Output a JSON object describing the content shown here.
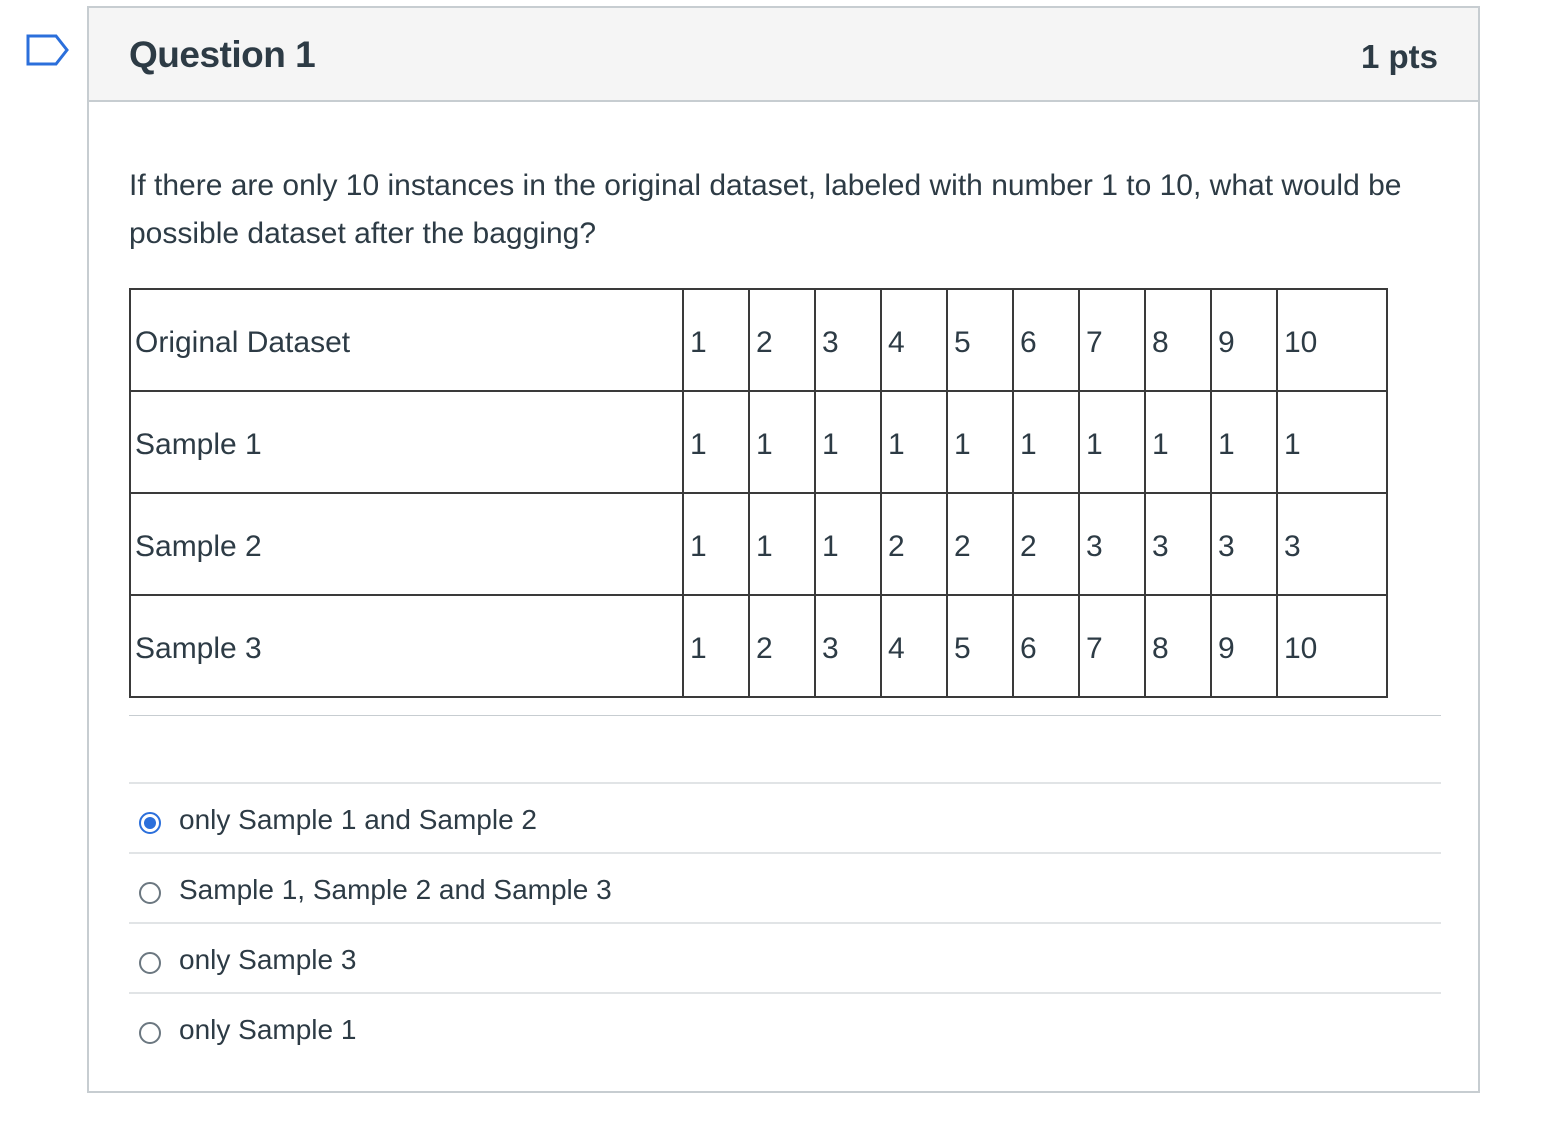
{
  "question": {
    "title": "Question 1",
    "points": "1 pts",
    "text": "If there are only 10 instances in the original dataset, labeled with number 1 to 10, what would be possible dataset after the bagging?"
  },
  "table": {
    "rows": [
      {
        "label": "Original Dataset",
        "values": [
          "1",
          "2",
          "3",
          "4",
          "5",
          "6",
          "7",
          "8",
          "9",
          "10"
        ]
      },
      {
        "label": "Sample 1",
        "values": [
          "1",
          "1",
          "1",
          "1",
          "1",
          "1",
          "1",
          "1",
          "1",
          "1"
        ]
      },
      {
        "label": "Sample 2",
        "values": [
          "1",
          "1",
          "1",
          "2",
          "2",
          "2",
          "3",
          "3",
          "3",
          "3"
        ]
      },
      {
        "label": "Sample 3",
        "values": [
          "1",
          "2",
          "3",
          "4",
          "5",
          "6",
          "7",
          "8",
          "9",
          "10"
        ]
      }
    ]
  },
  "answers": [
    {
      "label": "only Sample 1 and Sample 2",
      "selected": true
    },
    {
      "label": "Sample 1, Sample 2 and Sample 3",
      "selected": false
    },
    {
      "label": "only Sample 3",
      "selected": false
    },
    {
      "label": "only Sample 1",
      "selected": false
    }
  ],
  "colors": {
    "accent": "#2b6fdb",
    "text": "#2d3b45",
    "border": "#c7cdd1",
    "header_bg": "#f5f5f5"
  },
  "icons": {
    "flag": "flag-question-icon"
  }
}
